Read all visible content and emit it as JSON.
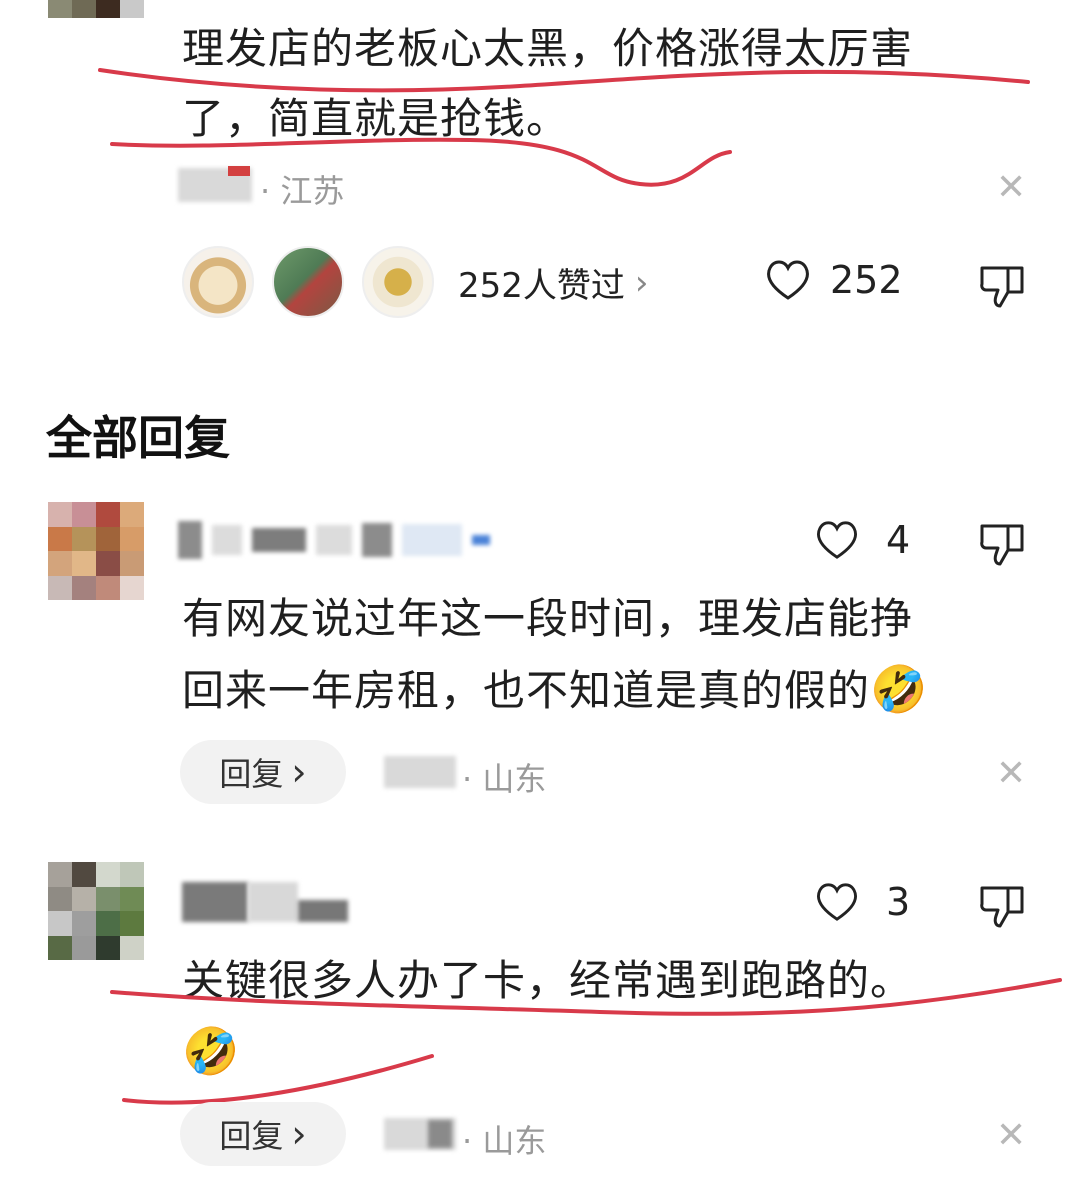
{
  "colors": {
    "annotation_red": "#d83a4a",
    "text": "#1f1f1f",
    "meta": "#9a9a9a"
  },
  "top_comment": {
    "text_line1": "理发店的老板心太黑，价格涨得太厉害",
    "text_line2": "了，简直就是抢钱。",
    "location": "· 江苏",
    "likers_label": "252人赞过",
    "likers_chevron": "›",
    "like_count": "252",
    "close_glyph": "✕"
  },
  "section": {
    "title": "全部回复"
  },
  "replies": [
    {
      "like_count": "4",
      "text_line1": "有网友说过年这一段时间，理发店能挣",
      "text_line2": "回来一年房租，也不知道是真的假的",
      "emoji": "🤣",
      "reply_label": "回复",
      "reply_chevron": "›",
      "location": "· 山东",
      "close_glyph": "✕"
    },
    {
      "like_count": "3",
      "text_line1": "关键很多人办了卡，经常遇到跑路的。",
      "emoji": "🤣",
      "reply_label": "回复",
      "reply_chevron": "›",
      "location": "· 山东",
      "close_glyph": "✕"
    }
  ]
}
